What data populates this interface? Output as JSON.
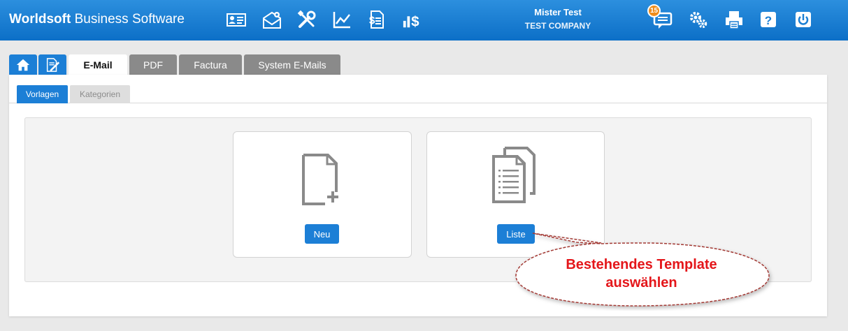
{
  "header": {
    "brand_bold": "Worldsoft",
    "brand_rest": " Business Software",
    "user_name": "Mister Test",
    "company": "TEST COMPANY",
    "notification_count": "15",
    "nav_icons": [
      "contact-card-icon",
      "mail-settings-icon",
      "tools-icon",
      "chart-icon",
      "invoice-icon",
      "finance-icon"
    ],
    "right_icons": [
      "chat-icon",
      "gears-icon",
      "printer-icon",
      "help-icon",
      "power-icon"
    ]
  },
  "tabs": {
    "icon_tabs": [
      "home-icon",
      "template-edit-icon"
    ],
    "items": [
      {
        "label": "E-Mail",
        "active": true
      },
      {
        "label": "PDF",
        "active": false
      },
      {
        "label": "Factura",
        "active": false
      },
      {
        "label": "System E-Mails",
        "active": false
      }
    ]
  },
  "subtabs": [
    {
      "label": "Vorlagen",
      "active": true
    },
    {
      "label": "Kategorien",
      "active": false
    }
  ],
  "cards": {
    "new": {
      "icon": "new-document-icon",
      "button": "Neu"
    },
    "list": {
      "icon": "document-list-icon",
      "button": "Liste"
    }
  },
  "callout": {
    "line1": "Bestehendes Template",
    "line2": "auswählen",
    "color": "#e4161a"
  },
  "colors": {
    "primary": "#1c7fd6",
    "header_gradient_top": "#2c8fde",
    "header_gradient_bottom": "#0c6fc7",
    "badge": "#f08c1a"
  }
}
